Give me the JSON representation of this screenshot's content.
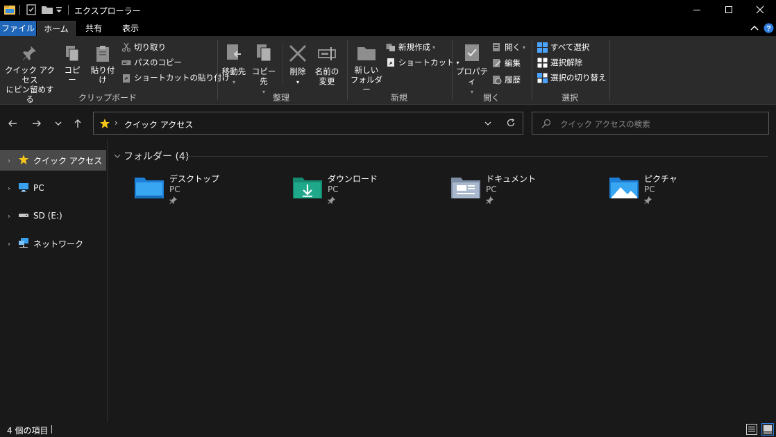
{
  "window": {
    "title": "エクスプローラー",
    "controls": {
      "minimize": "minimize",
      "maximize": "maximize",
      "close": "close"
    }
  },
  "ribbon_tabs": [
    {
      "label": "ファイル",
      "active": false
    },
    {
      "label": "ホーム",
      "active": true
    },
    {
      "label": "共有",
      "active": false
    },
    {
      "label": "表示",
      "active": false
    }
  ],
  "ribbon": {
    "clipboard": {
      "label": "クリップボード",
      "pin_line1": "クイック アクセス",
      "pin_line2": "にピン留めする",
      "copy": "コピー",
      "paste": "貼り付け",
      "cut": "切り取り",
      "copy_path": "パスのコピー",
      "paste_shortcut": "ショートカットの貼り付け"
    },
    "organize": {
      "label": "整理",
      "move_to": "移動先",
      "copy_to": "コピー先",
      "delete": "削除",
      "rename_line1": "名前の",
      "rename_line2": "変更"
    },
    "new": {
      "label": "新規",
      "new_folder_line1": "新しい",
      "new_folder_line2": "フォルダー",
      "new_item": "新規作成",
      "easy_access": "ショートカット"
    },
    "open": {
      "label": "開く",
      "properties": "プロパティ",
      "open": "開く",
      "edit": "編集",
      "history": "履歴"
    },
    "select": {
      "label": "選択",
      "select_all": "すべて選択",
      "select_none": "選択解除",
      "invert": "選択の切り替え"
    }
  },
  "address": {
    "location": "クイック アクセス",
    "search_placeholder": "クイック アクセスの検索"
  },
  "nav_pane": [
    {
      "label": "クイック アクセス",
      "icon": "star-icon",
      "selected": true
    },
    {
      "label": "PC",
      "icon": "pc-icon",
      "selected": false
    },
    {
      "label": "SD (E:)",
      "icon": "drive-icon",
      "selected": false
    },
    {
      "label": "ネットワーク",
      "icon": "network-icon",
      "selected": false
    }
  ],
  "section": {
    "title": "フォルダー (4)"
  },
  "folders": [
    {
      "name": "デスクトップ",
      "location": "PC",
      "icon": "desktop-folder-icon"
    },
    {
      "name": "ダウンロード",
      "location": "PC",
      "icon": "downloads-folder-icon"
    },
    {
      "name": "ドキュメント",
      "location": "PC",
      "icon": "documents-folder-icon"
    },
    {
      "name": "ピクチャ",
      "location": "PC",
      "icon": "pictures-folder-icon"
    }
  ],
  "status": {
    "item_count": "4 個の項目"
  },
  "colors": {
    "titlebar": "#000000",
    "ribbon": "#2b2b2b",
    "background": "#191919",
    "file_tab": "#1f66b8",
    "accent_blue": "#1e90ff",
    "star": "#f5c518",
    "downloads_teal": "#1fa98a"
  }
}
